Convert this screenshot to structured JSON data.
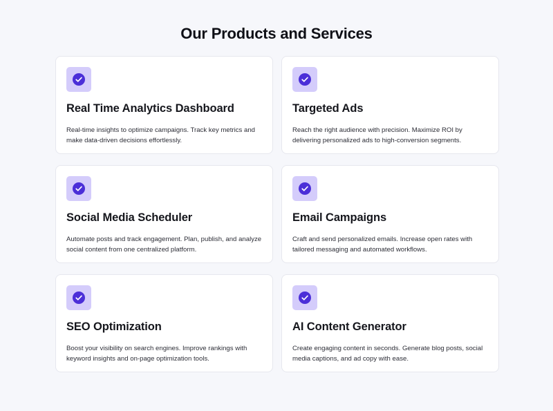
{
  "page": {
    "title": "Our Products and Services"
  },
  "colors": {
    "background": "#f6f7fb",
    "card": "#ffffff",
    "icon_tile": "#d4ccfb",
    "icon_circle": "#4b2fd8"
  },
  "cards": [
    {
      "icon": "check-circle-icon",
      "title": "Real Time Analytics Dashboard",
      "description": "Real-time insights to optimize campaigns. Track key metrics and make data-driven decisions effortlessly."
    },
    {
      "icon": "check-circle-icon",
      "title": "Targeted Ads",
      "description": "Reach the right audience with precision. Maximize ROI by delivering personalized ads to high-conversion segments."
    },
    {
      "icon": "check-circle-icon",
      "title": "Social Media Scheduler",
      "description": "Automate posts and track engagement. Plan, publish, and analyze social content from one centralized platform."
    },
    {
      "icon": "check-circle-icon",
      "title": "Email Campaigns",
      "description": "Craft and send personalized emails. Increase open rates with tailored messaging and automated workflows."
    },
    {
      "icon": "check-circle-icon",
      "title": "SEO Optimization",
      "description": "Boost your visibility on search engines. Improve rankings with keyword insights and on-page optimization tools."
    },
    {
      "icon": "check-circle-icon",
      "title": "AI Content Generator",
      "description": "Create engaging content in seconds. Generate blog posts, social media captions, and ad copy with ease."
    }
  ]
}
